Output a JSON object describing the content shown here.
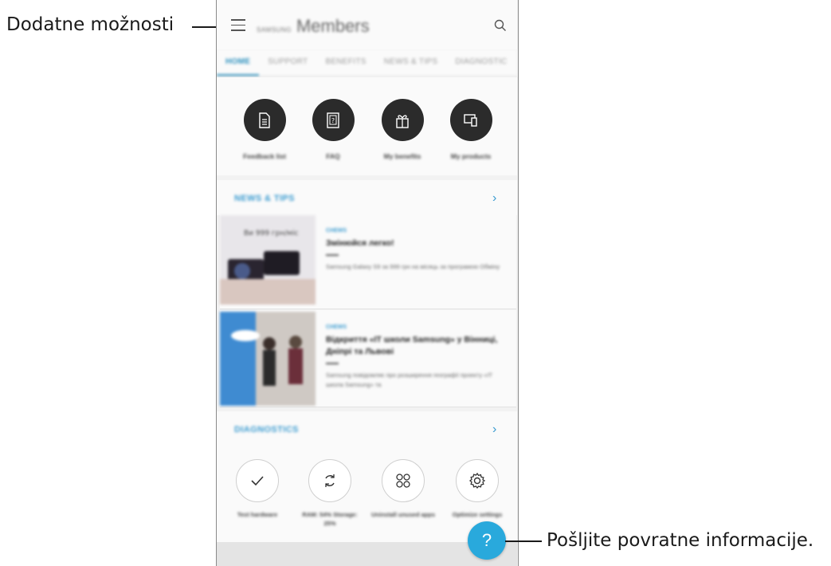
{
  "callouts": {
    "more_options": "Dodatne možnosti",
    "send_feedback": "Pošljite povratne informacije."
  },
  "appbar": {
    "brand_small": "SAMSUNG",
    "brand_big": "Members",
    "menu_icon": "hamburger-menu-icon",
    "search_icon": "search-icon"
  },
  "tabs": [
    {
      "label": "HOME",
      "active": true
    },
    {
      "label": "SUPPORT",
      "active": false
    },
    {
      "label": "BENEFITS",
      "active": false
    },
    {
      "label": "NEWS & TIPS",
      "active": false
    },
    {
      "label": "DIAGNOSTIC",
      "active": false
    }
  ],
  "quick_actions": [
    {
      "label": "Feedback list",
      "icon": "document-icon"
    },
    {
      "label": "FAQ",
      "icon": "faq-icon"
    },
    {
      "label": "My benefits",
      "icon": "gift-icon"
    },
    {
      "label": "My products",
      "icon": "devices-icon"
    }
  ],
  "news_section": {
    "title": "NEWS & TIPS",
    "chevron": "›",
    "items": [
      {
        "tag": "СНЕWS",
        "title": "Змінюйся легко!",
        "desc": "Samsung Galaxy S9 за 999 грн на місяць за програмою Обмінy",
        "thumb_overlay": "Ви 999 грн/міс"
      },
      {
        "tag": "СНЕWS",
        "title": "Відкриття «IT школи Samsung» у Вінниці, Дніпрі та Львові",
        "desc": "Samsung повідомляє про розширення географії проекту «IT школа Samsung» та"
      }
    ]
  },
  "diagnostics_section": {
    "title": "DIAGNOSTICS",
    "chevron": "›",
    "items": [
      {
        "label": "Test hardware",
        "icon": "check-icon"
      },
      {
        "label": "RAM: 54% Storage: 25%",
        "icon": "refresh-icon"
      },
      {
        "label": "Uninstall unused apps",
        "icon": "apps-grid-icon"
      },
      {
        "label": "Optimize settings",
        "icon": "gear-icon"
      }
    ]
  },
  "fab": {
    "label": "?",
    "icon": "help-icon"
  },
  "colors": {
    "accent": "#2a8fbd",
    "fab": "#29a9dc",
    "dark_circle": "#2b2b2b"
  }
}
